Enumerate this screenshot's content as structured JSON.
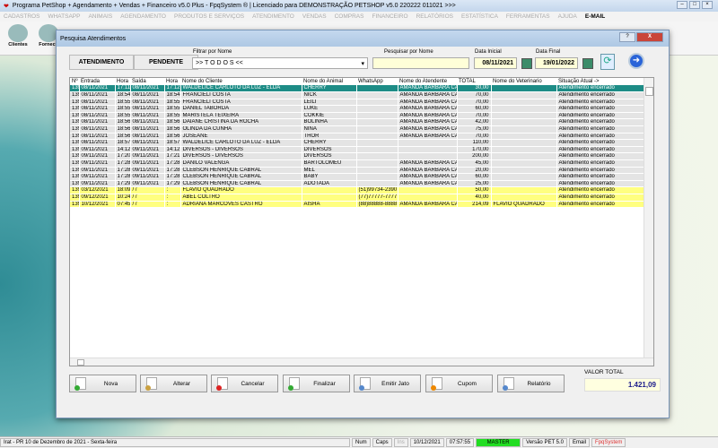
{
  "app": {
    "title": "Programa PetShop + Agendamento + Vendas + Financeiro v5.0 Plus - FpqSystem ® | Licenciado para  DEMONSTRAÇÃO PETSHOP v5.0 220222 011021 >>>"
  },
  "menu": [
    "CADASTROS",
    "WHATSAPP",
    "ANIMAIS",
    "AGENDAMENTO",
    "PRODUTOS E SERVIÇOS",
    "ATENDIMENTO",
    "VENDAS",
    "COMPRAS",
    "FINANCEIRO",
    "RELATÓRIOS",
    "ESTATÍSTICA",
    "FERRAMENTAS",
    "AJUDA",
    "E-MAIL"
  ],
  "toolbar": {
    "clientes": "Clientes",
    "fornecedores": "Fornece"
  },
  "dialog": {
    "title": "Pesquisa Atendimentos",
    "tab_atendimento": "ATENDIMENTO",
    "tab_pendente": "PENDENTE",
    "filter_label": "Filtrar por Nome",
    "filter_value": ">> T O D O S <<",
    "search_label": "Pesquisar por Nome",
    "search_value": "",
    "date_start_label": "Data Inicial",
    "date_start": "08/11/2021",
    "date_end_label": "Data Final",
    "date_end": "19/01/2022",
    "columns": [
      "Nº",
      "Entrada",
      "Hora",
      "Saída",
      "Hora",
      "Nome do Cliente",
      "Nome do Animal",
      "WhatsApp",
      "Nome do Atendente",
      "TOTAL",
      "Nome do Veterinario",
      "Situação Atual ->"
    ],
    "rows": [
      [
        "13941",
        "08/11/2021",
        "17:11",
        "08/11/2021",
        "17:12",
        "WALDELICE CARLOTO DA LUZ - ELDA",
        "CHERRY",
        "",
        "AMANDA BARBARA CA",
        "30,00",
        "",
        "Atendimento encerrado"
      ],
      [
        "13942",
        "08/11/2021",
        "18:54",
        "08/11/2021",
        "18:54",
        "FRANCIELI COSTA",
        "NICK",
        "",
        "AMANDA BARBARA CA",
        "70,00",
        "",
        "Atendimento encerrado"
      ],
      [
        "13943",
        "08/11/2021",
        "18:55",
        "08/11/2021",
        "18:55",
        "FRANCIELI COSTA",
        "LEILI",
        "",
        "AMANDA BARBARA CA",
        "70,00",
        "",
        "Atendimento encerrado"
      ],
      [
        "13944",
        "08/11/2021",
        "18:55",
        "08/11/2021",
        "18:55",
        "DANIEL TABORDA",
        "LUKE",
        "",
        "AMANDA BARBARA CA",
        "60,00",
        "",
        "Atendimento encerrado"
      ],
      [
        "13945",
        "08/11/2021",
        "18:55",
        "08/11/2021",
        "18:55",
        "MARISTELA TEIXEIRA",
        "COKKIE",
        "",
        "AMANDA BARBARA CA",
        "70,00",
        "",
        "Atendimento encerrado"
      ],
      [
        "13946",
        "08/11/2021",
        "18:56",
        "08/11/2021",
        "18:56",
        "DAIANE CRISTINA DA ROCHA",
        "BOLINHA",
        "",
        "AMANDA BARBARA CA",
        "42,00",
        "",
        "Atendimento encerrado"
      ],
      [
        "13947",
        "08/11/2021",
        "18:56",
        "08/11/2021",
        "18:56",
        "OLINDA DA CUNHA",
        "NINA",
        "",
        "AMANDA BARBARA CA",
        "75,00",
        "",
        "Atendimento encerrado"
      ],
      [
        "13948",
        "08/11/2021",
        "18:56",
        "08/11/2021",
        "18:56",
        "JOSEANE",
        "THOR",
        "",
        "AMANDA BARBARA CA",
        "70,00",
        "",
        "Atendimento encerrado"
      ],
      [
        "13949",
        "08/11/2021",
        "18:57",
        "08/11/2021",
        "18:57",
        "WALDELICE CARLOTO DA LUZ - ELDA",
        "CHERRY",
        "",
        "",
        "110,00",
        "",
        "Atendimento encerrado"
      ],
      [
        "13951",
        "09/11/2021",
        "14:12",
        "09/11/2021",
        "14:12",
        "DIVERSOS - DIVERSOS",
        "DIVERSOS",
        "",
        "",
        "170,00",
        "",
        "Atendimento encerrado"
      ],
      [
        "13952",
        "09/11/2021",
        "17:20",
        "09/11/2021",
        "17:21",
        "DIVERSOS - DIVERSOS",
        "DIVERSOS",
        "",
        "",
        "200,00",
        "",
        "Atendimento encerrado"
      ],
      [
        "13953",
        "09/11/2021",
        "17:28",
        "09/11/2021",
        "17:28",
        "DANILO VALENGA",
        "BARTOLOMEU",
        "",
        "AMANDA BARBARA CA",
        "45,00",
        "",
        "Atendimento encerrado"
      ],
      [
        "13954",
        "09/11/2021",
        "17:28",
        "09/11/2021",
        "17:28",
        "CLEBSON HENRIQUE CABRAL",
        "MEL",
        "",
        "AMANDA BARBARA CA",
        "20,00",
        "",
        "Atendimento encerrado"
      ],
      [
        "13955",
        "09/11/2021",
        "17:28",
        "09/11/2021",
        "17:28",
        "CLEBSON HENRIQUE CABRAL",
        "BABY",
        "",
        "AMANDA BARBARA CA",
        "60,00",
        "",
        "Atendimento encerrado"
      ],
      [
        "13956",
        "09/11/2021",
        "17:29",
        "09/11/2021",
        "17:29",
        "CLEBSON HENRIQUE CABRAL",
        "ADOTADA",
        "",
        "AMANDA BARBARA CA",
        "25,00",
        "",
        "Atendimento encerrado"
      ],
      [
        "13957",
        "03/12/2021",
        "18:09",
        " / /",
        ":",
        "FLAVIO QUADRADO",
        "",
        "(51)99734-2390",
        "",
        "50,00",
        "",
        "Atendimento encerrado"
      ],
      [
        "13958",
        "09/12/2021",
        "10:24",
        " / /",
        ":",
        "ABEL COLTRO",
        "",
        "(77)77777-7777",
        "",
        "40,00",
        "",
        "Atendimento encerrado"
      ],
      [
        "13959",
        "10/12/2021",
        "07:45",
        " / /",
        ":",
        "ADRIANA MARCOVES CASTRO",
        "AISHA",
        "(88)88888-8888",
        "AMANDA BARBARA CA",
        "214,09",
        "FLAVIO QUADRADO",
        "Atendimento encerrado"
      ]
    ],
    "selected_row": 0,
    "pending_rows": [
      15,
      16,
      17
    ],
    "buttons": [
      "Nova",
      "Alterar",
      "Cancelar",
      "Finalizar",
      "Emitir Jato",
      "Cupom",
      "Relatório"
    ],
    "total_label": "VALOR TOTAL",
    "total_value": "1.421,09"
  },
  "status": {
    "location": "Irat - PR 10 de Dezembro de 2021 - Sexta-feira",
    "num": "Num",
    "caps": "Caps",
    "ins": "Ins",
    "date": "10/12/2021",
    "time": "07:57:55",
    "user": "MASTER",
    "version": "Versão PET 5.0",
    "email": "Email",
    "brand": "FpqSystem"
  },
  "colors": {
    "selected": "#1d8c86",
    "pending": "#ffff80",
    "master": "#22dd22"
  }
}
